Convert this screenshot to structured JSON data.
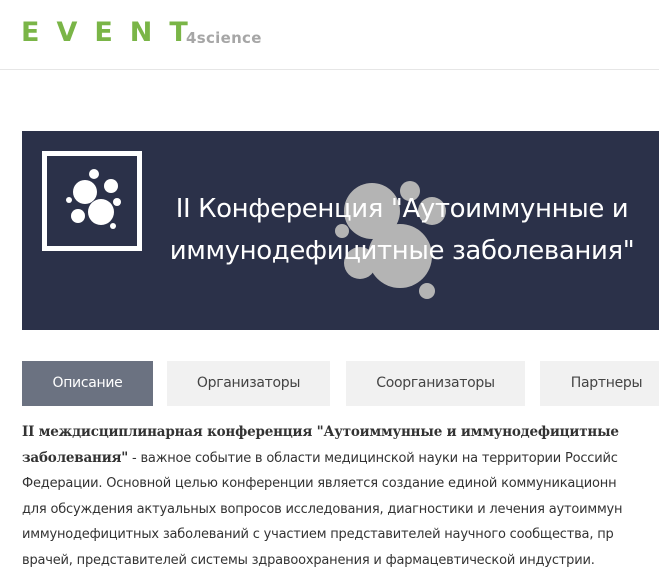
{
  "header": {
    "logo_main": "EVENT",
    "logo_sub": "4science"
  },
  "banner": {
    "title_line1": "II Конференция \"Аутоиммунные и",
    "title_line2": "иммунодефицитные заболевания\""
  },
  "tabs": [
    {
      "label": "Описание",
      "active": true
    },
    {
      "label": "Организаторы",
      "active": false
    },
    {
      "label": "Соорганизаторы",
      "active": false
    },
    {
      "label": "Партнеры",
      "active": false
    }
  ],
  "description": {
    "bold_line1": "II междисциплинарная конференция \"Аутоиммунные и иммунодефицитные",
    "bold_line2": "заболевания\"",
    "rest_line2": " - важное событие в области медицинской науки на территории Российс",
    "line3": "Федерации. Основной целью конференции является создание единой коммуникационн",
    "line4": "для обсуждения актуальных вопросов исследования, диагностики и лечения аутоиммун",
    "line5": "иммунодефицитных заболеваний с участием представителей научного сообщества, пр",
    "line6": "врачей, представителей системы здравоохранения и фармацевтической индустрии."
  },
  "colors": {
    "brand_green": "#7ab547",
    "banner_bg": "#2b3149",
    "tab_active": "#6b7281",
    "tab_inactive": "#f1f1f1"
  }
}
